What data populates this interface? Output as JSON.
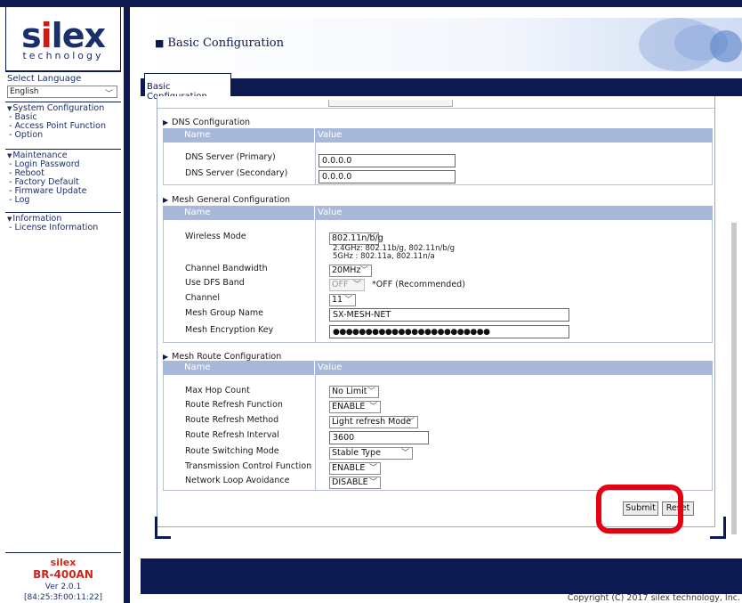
{
  "logo": {
    "main_pre": "s",
    "main_i": "i",
    "main_post": "lex",
    "sub": "technology"
  },
  "language": {
    "label": "Select Language",
    "selected": "English"
  },
  "menu": {
    "system": {
      "heading": "System Configuration",
      "items": [
        "- Basic",
        "- Access Point Function",
        "- Option"
      ]
    },
    "maintenance": {
      "heading": "Maintenance",
      "items": [
        "- Login Password",
        "- Reboot",
        "- Factory Default",
        "- Firmware Update",
        "- Log"
      ]
    },
    "information": {
      "heading": "Information",
      "items": [
        "- License Information"
      ]
    }
  },
  "footer": {
    "brand": "silex",
    "model": "BR-400AN",
    "version": "Ver 2.0.1",
    "mac": "[84:25:3f:00:11:22]"
  },
  "header": {
    "title": "Basic Configuration"
  },
  "tab": {
    "label": "Basic Configuration"
  },
  "columns": {
    "name": "Name",
    "value": "Value"
  },
  "dns": {
    "title": "DNS Configuration",
    "primary_label": "DNS Server (Primary)",
    "primary_value": "0.0.0.0",
    "secondary_label": "DNS Server (Secondary)",
    "secondary_value": "0.0.0.0"
  },
  "mesh": {
    "title": "Mesh General Configuration",
    "wireless_label": "Wireless Mode",
    "wireless_value": "802.11n/b/g",
    "wireless_hint1": "2.4GHz: 802.11b/g, 802.11n/b/g",
    "wireless_hint2": "5GHz   : 802.11a, 802.11n/a",
    "bandwidth_label": "Channel Bandwidth",
    "bandwidth_value": "20MHz",
    "dfs_label": "Use DFS Band",
    "dfs_value": "OFF",
    "dfs_note": "*OFF (Recommended)",
    "channel_label": "Channel",
    "channel_value": "11",
    "group_label": "Mesh Group Name",
    "group_value": "SX-MESH-NET",
    "key_label": "Mesh Encryption Key",
    "key_value": "●●●●●●●●●●●●●●●●●●●●●●●●"
  },
  "route": {
    "title": "Mesh Route Configuration",
    "hop_label": "Max Hop Count",
    "hop_value": "No Limit",
    "refresh_fn_label": "Route Refresh Function",
    "refresh_fn_value": "ENABLE",
    "refresh_method_label": "Route Refresh Method",
    "refresh_method_value": "Light refresh Mode",
    "refresh_interval_label": "Route Refresh Interval",
    "refresh_interval_value": "3600",
    "switching_label": "Route Switching Mode",
    "switching_value": "Stable Type",
    "tx_label": "Transmission Control Function",
    "tx_value": "ENABLE",
    "loop_label": "Network Loop Avoidance",
    "loop_value": "DISABLE"
  },
  "buttons": {
    "submit": "Submit",
    "reset": "Reset"
  },
  "copyright": "Copyright (C) 2017 silex technology, Inc.",
  "colors": {
    "navy": "#0d1a52",
    "header_bg": "#a8b8d8",
    "highlight": "#e60012",
    "brand_red": "#c8281e"
  }
}
